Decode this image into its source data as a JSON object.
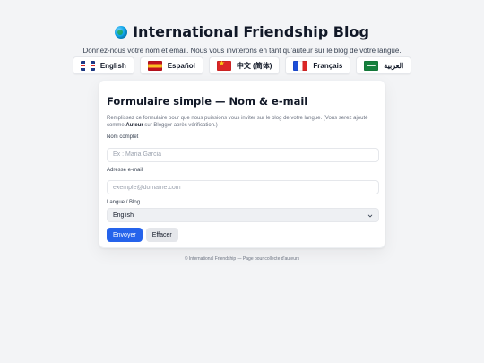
{
  "header": {
    "title": "International Friendship Blog",
    "subtitle": "Donnez-nous votre nom et email. Nous vous inviterons en tant qu'auteur sur le blog de votre langue."
  },
  "languages": [
    {
      "label": "English",
      "flag_icon": "uk-flag-icon"
    },
    {
      "label": "Español",
      "flag_icon": "spain-flag-icon"
    },
    {
      "label": "中文 (简体)",
      "flag_icon": "china-flag-icon"
    },
    {
      "label": "Français",
      "flag_icon": "france-flag-icon"
    },
    {
      "label": "العربية",
      "flag_icon": "saudi-flag-icon"
    }
  ],
  "form": {
    "title": "Formulaire simple — Nom & e-mail",
    "desc_prefix": "Remplissez ce formulaire pour que nous puissions vous inviter sur le blog de votre langue. (Vous serez ajouté comme ",
    "desc_strong": "Auteur",
    "desc_suffix": " sur Blogger après vérification.)",
    "name_label": "Nom complet",
    "name_placeholder": "Ex : Maria Garcia",
    "name_value": "",
    "email_label": "Adresse e-mail",
    "email_placeholder": "exemple@domaine.com",
    "email_value": "",
    "lang_label": "Langue / Blog",
    "lang_selected": "English",
    "submit_label": "Envoyer",
    "clear_label": "Effacer"
  },
  "footer": {
    "text": "© International Friendship — Page pour collecte d'auteurs"
  },
  "colors": {
    "background": "#f3f4f6",
    "card": "#ffffff",
    "primary_button": "#2563eb",
    "secondary_button": "#e5e7eb"
  }
}
